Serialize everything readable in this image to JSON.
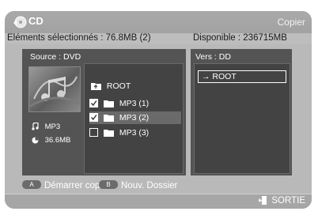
{
  "window": {
    "title": "CD",
    "mode": "Copier"
  },
  "info": {
    "selected": "Eléments sélectionnés : 76.8MB  (2)",
    "available": "Disponible : 236715MB"
  },
  "source": {
    "label": "Source : DVD",
    "file_type": "MP3",
    "file_size": "36.6MB",
    "tree": {
      "root": "ROOT",
      "items": [
        {
          "label": "MP3 (1)",
          "checked": true,
          "highlighted": false
        },
        {
          "label": "MP3 (2)",
          "checked": true,
          "highlighted": true
        },
        {
          "label": "MP3 (3)",
          "checked": false,
          "highlighted": false
        }
      ]
    }
  },
  "destination": {
    "label": "Vers : DD",
    "selected": "→ ROOT"
  },
  "help": {
    "a_key": "A",
    "a_label": "Démarrer copie",
    "b_key": "B",
    "b_label": "Nouv. Dossier"
  },
  "footer": {
    "exit_label": "SORTIE"
  },
  "colors": {
    "panel": "#545454",
    "list_bg": "#434343",
    "frame": "#b9b9b9"
  }
}
